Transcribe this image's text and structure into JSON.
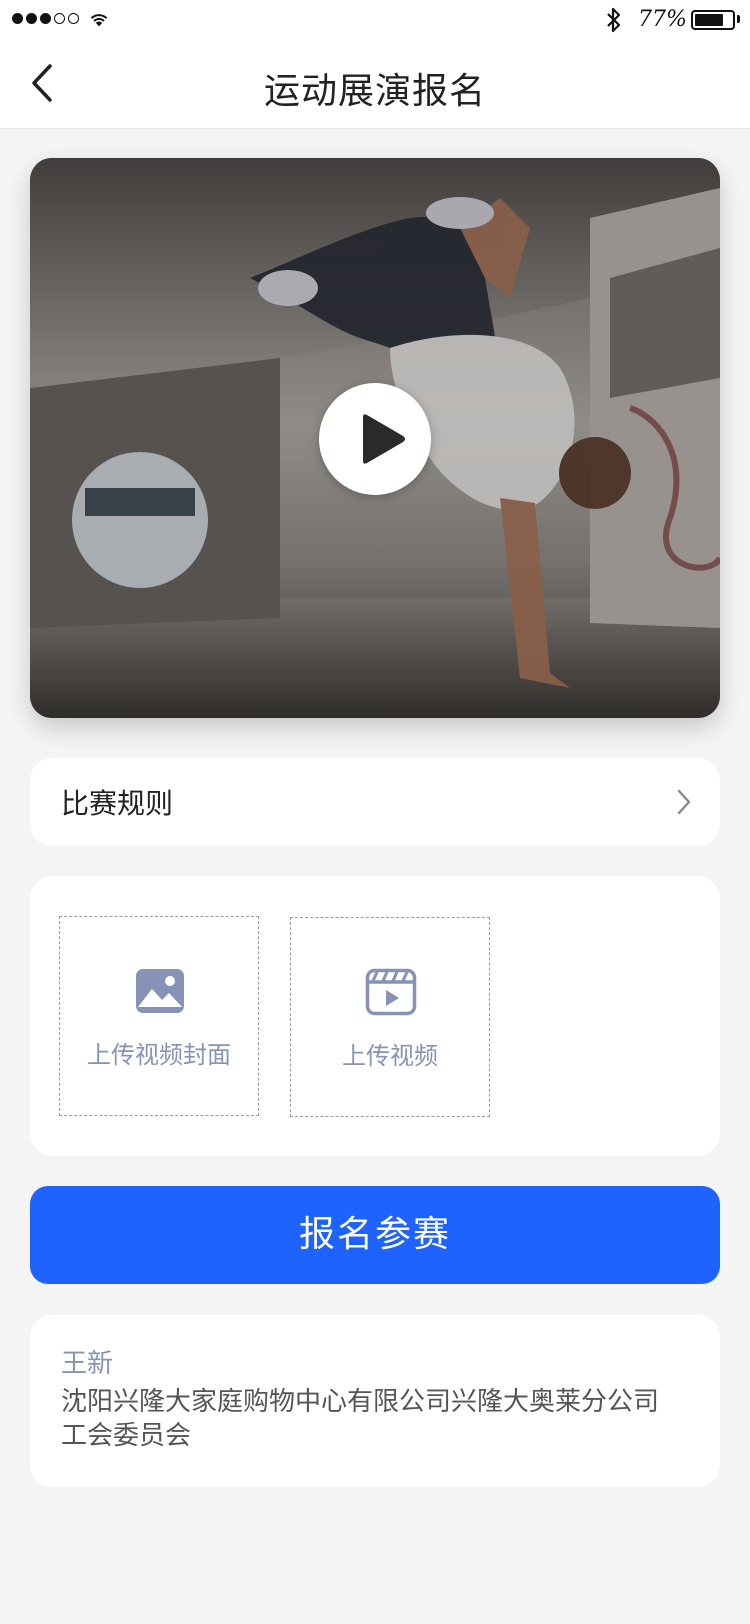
{
  "status_bar": {
    "battery_percent": "77%",
    "battery_level": 0.77,
    "signal_bars_filled": 3,
    "signal_bars_total": 5
  },
  "nav": {
    "title": "运动展演报名"
  },
  "video": {
    "description_icon": "play-icon"
  },
  "rules": {
    "label": "比赛规则"
  },
  "upload": {
    "cover_label": "上传视频封面",
    "video_label": "上传视频"
  },
  "submit": {
    "label": "报名参赛"
  },
  "info": {
    "name": "王新",
    "organization": "沈阳兴隆大家庭购物中心有限公司兴隆大奥莱分公司工会委员会"
  },
  "colors": {
    "primary": "#1f63ff",
    "muted_blue": "#8693b6",
    "background": "#f4f4f5"
  }
}
